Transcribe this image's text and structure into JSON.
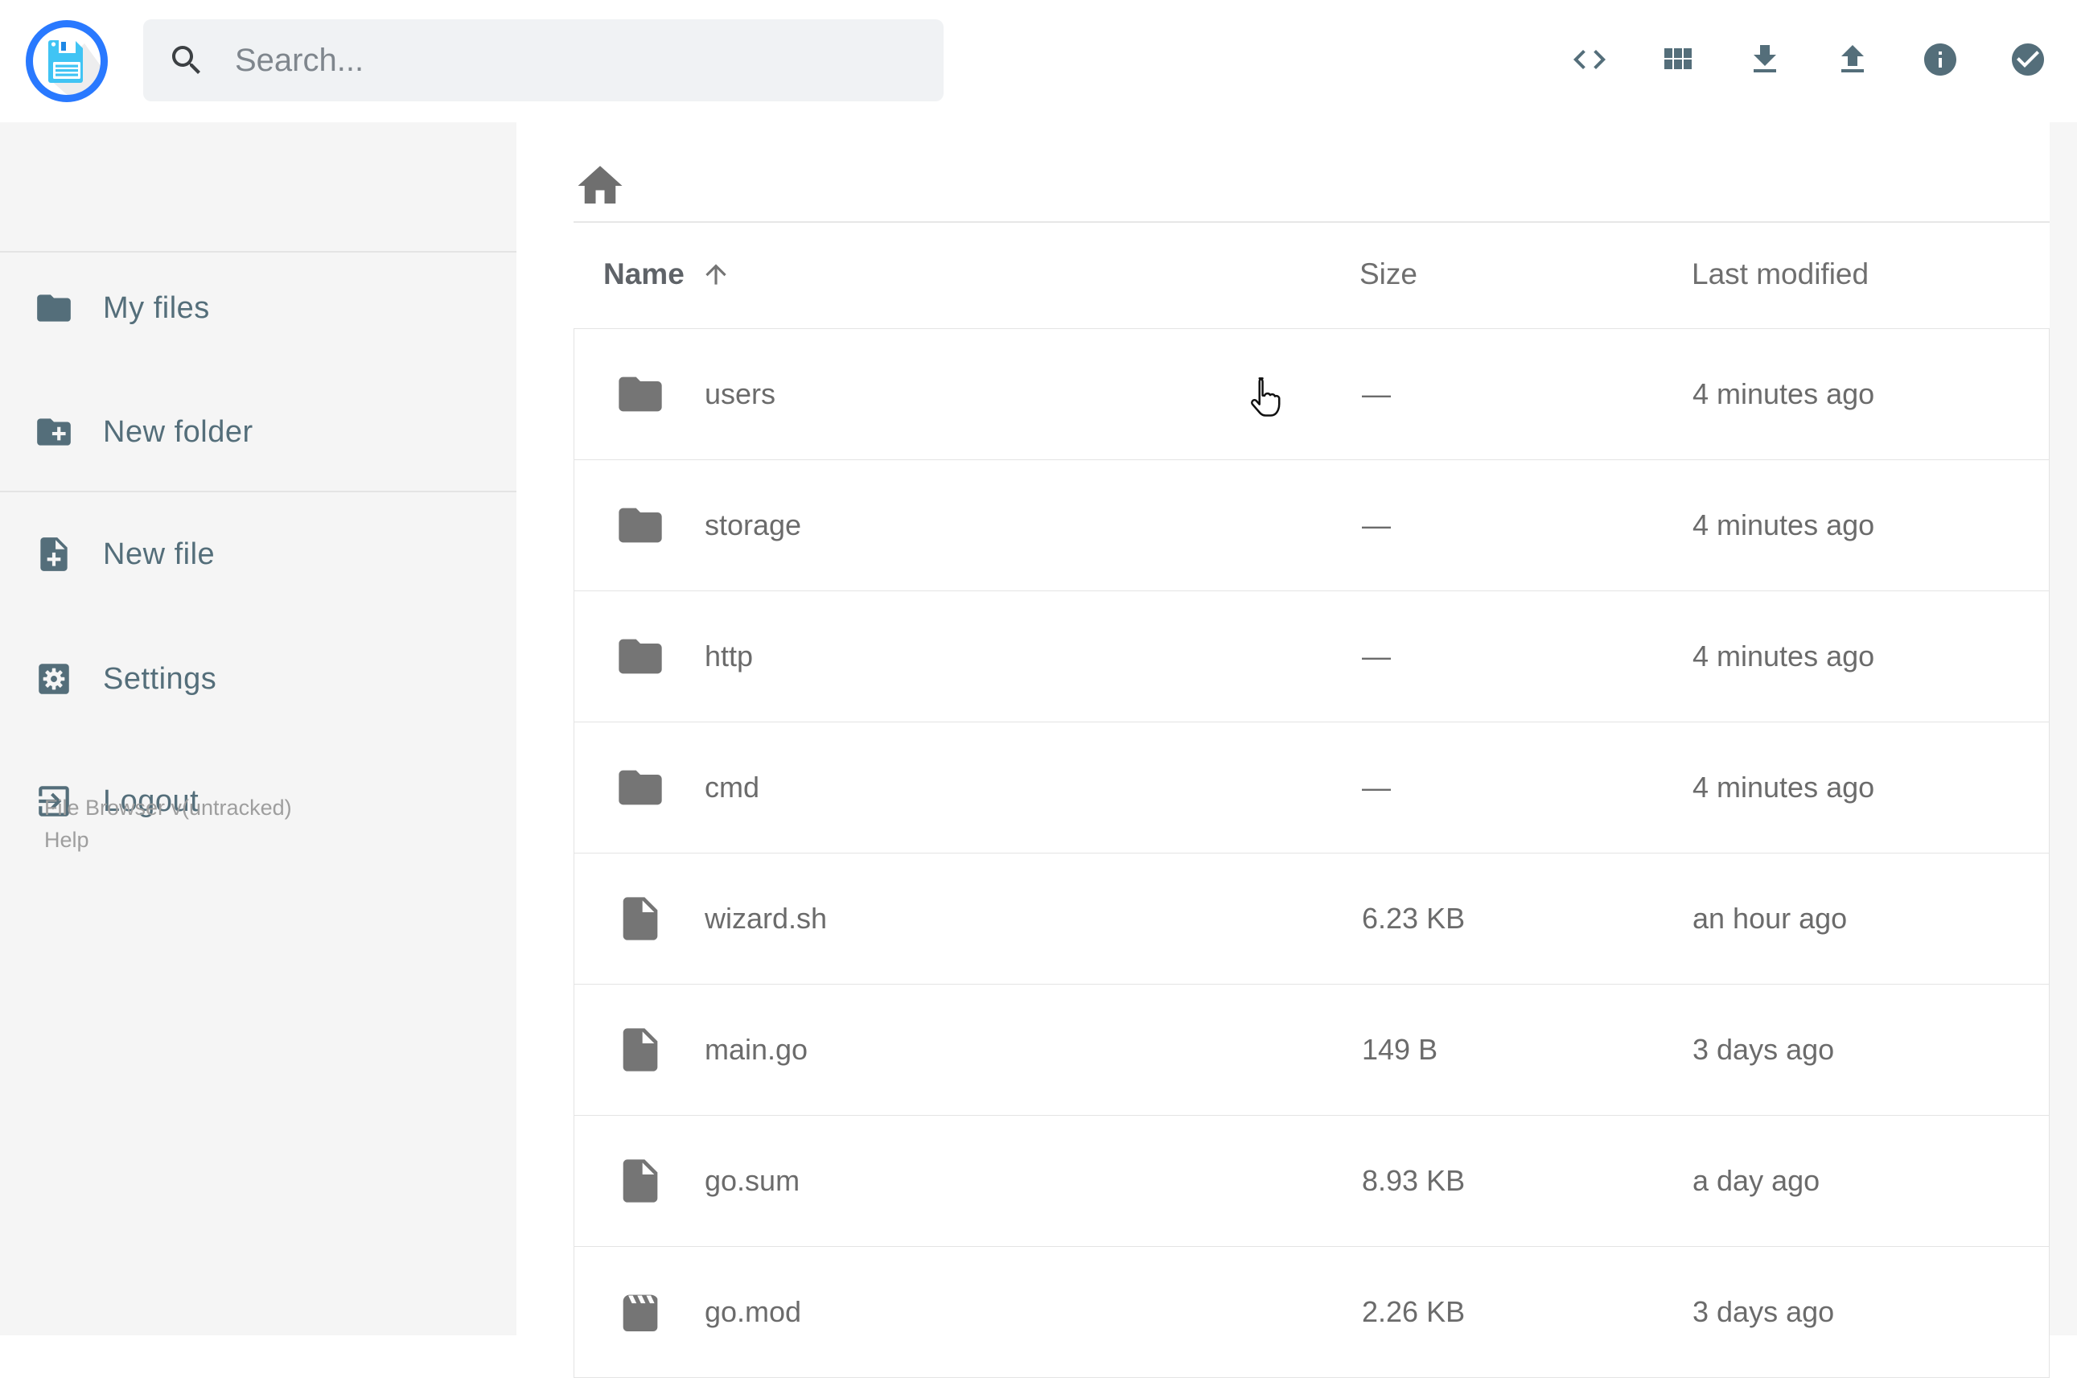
{
  "app": {
    "title": "File Browser"
  },
  "header": {
    "search": {
      "placeholder": "Search...",
      "icon": "search-icon"
    },
    "actions": [
      {
        "id": "shell",
        "icon": "code-icon"
      },
      {
        "id": "switch-view",
        "icon": "grid-view-icon"
      },
      {
        "id": "download",
        "icon": "download-icon"
      },
      {
        "id": "upload",
        "icon": "upload-icon"
      },
      {
        "id": "info",
        "icon": "info-icon"
      },
      {
        "id": "select-multiple",
        "icon": "check-circle-icon"
      }
    ]
  },
  "sidebar": {
    "items": [
      {
        "label": "My files",
        "icon": "folder-icon"
      },
      {
        "label": "New folder",
        "icon": "new-folder-icon"
      },
      {
        "label": "New file",
        "icon": "new-file-icon"
      },
      {
        "label": "Settings",
        "icon": "settings-icon"
      },
      {
        "label": "Logout",
        "icon": "logout-icon"
      }
    ],
    "footer": {
      "version": "File Browser v(untracked)",
      "help": "Help"
    }
  },
  "listing": {
    "breadcrumb": {
      "icon": "home-icon"
    },
    "columns": {
      "name": "Name",
      "size": "Size",
      "modified": "Last modified"
    },
    "sort": {
      "column": "Name",
      "direction": "ascending",
      "icon": "arrow-up-icon"
    },
    "rows": [
      {
        "name": "users",
        "type": "folder",
        "icon": "folder-icon",
        "size": "—",
        "modified": "4 minutes ago"
      },
      {
        "name": "storage",
        "type": "folder",
        "icon": "folder-icon",
        "size": "—",
        "modified": "4 minutes ago"
      },
      {
        "name": "http",
        "type": "folder",
        "icon": "folder-icon",
        "size": "—",
        "modified": "4 minutes ago"
      },
      {
        "name": "cmd",
        "type": "folder",
        "icon": "folder-icon",
        "size": "—",
        "modified": "4 minutes ago"
      },
      {
        "name": "wizard.sh",
        "type": "file",
        "icon": "file-icon",
        "size": "6.23 KB",
        "modified": "an hour ago"
      },
      {
        "name": "main.go",
        "type": "file",
        "icon": "file-icon",
        "size": "149 B",
        "modified": "3 days ago"
      },
      {
        "name": "go.sum",
        "type": "file",
        "icon": "file-icon",
        "size": "8.93 KB",
        "modified": "a day ago"
      },
      {
        "name": "go.mod",
        "type": "file",
        "icon": "movie-icon",
        "size": "2.26 KB",
        "modified": "3 days ago"
      }
    ]
  },
  "colors": {
    "accent_blue": "#2979ff",
    "floppy_blue": "#40c4f4",
    "icon_slate": "#546e7a",
    "row_text": "#6b6b6b",
    "sidebar_bg": "#f5f5f5",
    "search_bg": "#f0f2f4",
    "row_border": "#e4e4e4"
  }
}
